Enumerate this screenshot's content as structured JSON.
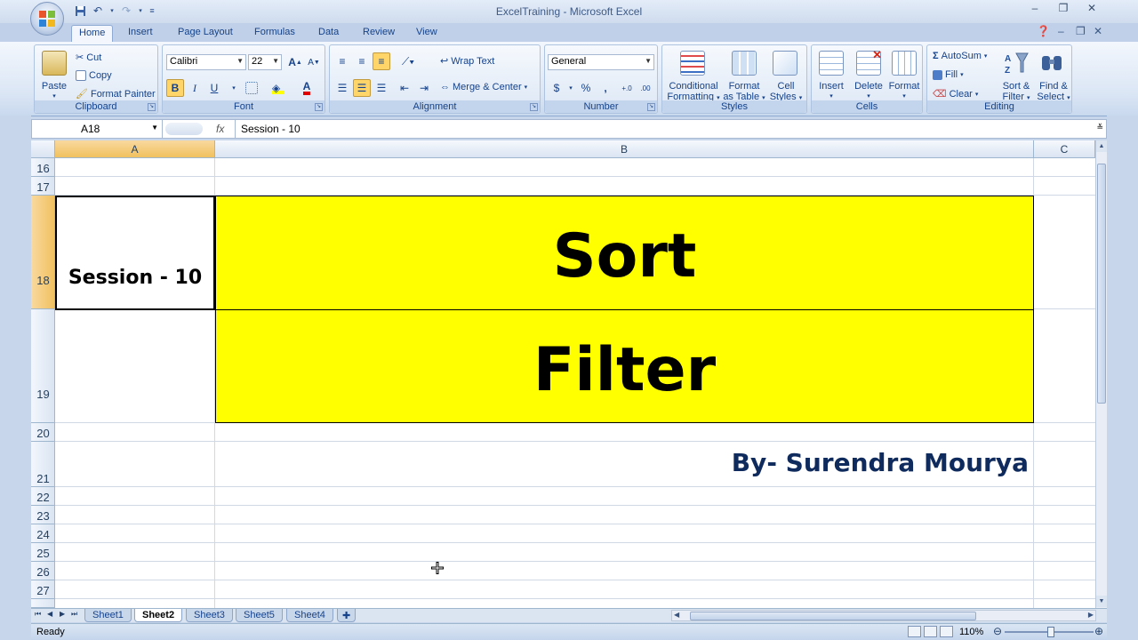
{
  "window": {
    "title": "ExcelTraining - Microsoft Excel",
    "minimize": "–",
    "restore": "❐",
    "close": "✕"
  },
  "tabs": [
    "Home",
    "Insert",
    "Page Layout",
    "Formulas",
    "Data",
    "Review",
    "View"
  ],
  "active_tab": "Home",
  "ribbon": {
    "clipboard": {
      "label": "Clipboard",
      "paste": "Paste",
      "cut": "Cut",
      "copy": "Copy",
      "format_painter": "Format Painter"
    },
    "font": {
      "label": "Font",
      "name": "Calibri",
      "size": "22",
      "bold": "B",
      "italic": "I",
      "underline": "U",
      "grow": "A",
      "shrink": "A"
    },
    "alignment": {
      "label": "Alignment",
      "wrap_text": "Wrap Text",
      "merge_center": "Merge & Center"
    },
    "number": {
      "label": "Number",
      "format": "General",
      "currency": "$",
      "percent": "%",
      "comma": ",",
      "inc_decimal": "+.0",
      "dec_decimal": ".00"
    },
    "styles": {
      "label": "Styles",
      "conditional": "Conditional Formatting",
      "conditional_1": "Conditional",
      "conditional_2": "Formatting",
      "format_table_1": "Format",
      "format_table_2": "as Table",
      "cell_styles_1": "Cell",
      "cell_styles_2": "Styles"
    },
    "cells": {
      "label": "Cells",
      "insert": "Insert",
      "delete": "Delete",
      "format": "Format"
    },
    "editing": {
      "label": "Editing",
      "autosum": "AutoSum",
      "fill": "Fill",
      "clear": "Clear",
      "sort_1": "Sort &",
      "sort_2": "Filter",
      "find_1": "Find &",
      "find_2": "Select"
    }
  },
  "formula_bar": {
    "name_box": "A18",
    "fx": "fx",
    "content": "Session - 10"
  },
  "columns": [
    "A",
    "B",
    "C"
  ],
  "rows": [
    "16",
    "17",
    "18",
    "19",
    "20",
    "21",
    "22",
    "23",
    "24",
    "25",
    "26",
    "27"
  ],
  "cells": {
    "A18": "Session - 10",
    "B18": "Sort",
    "B19": "Filter",
    "B21": "By- Surendra Mourya"
  },
  "sheet_tabs": [
    "Sheet1",
    "Sheet2",
    "Sheet3",
    "Sheet5",
    "Sheet4"
  ],
  "active_sheet": "Sheet2",
  "status": {
    "text": "Ready",
    "zoom": "110%"
  },
  "colors": {
    "highlight_fill": "#ffff00",
    "byline": "#0f2a5c"
  }
}
